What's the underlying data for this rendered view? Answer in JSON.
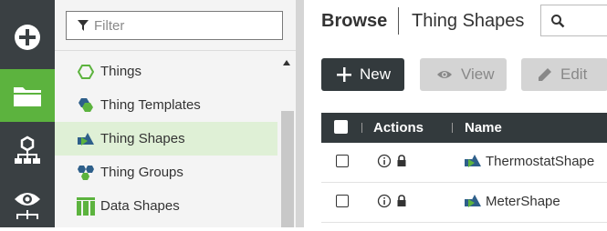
{
  "rail": {
    "items": [
      {
        "name": "add-icon",
        "active": false
      },
      {
        "name": "folder-icon",
        "active": true
      },
      {
        "name": "network-icon",
        "active": false
      },
      {
        "name": "monitoring-icon",
        "active": false
      }
    ]
  },
  "nav": {
    "filter_placeholder": "Filter",
    "items": [
      {
        "label": "Things",
        "icon": "hexagon-outline-icon",
        "selected": false
      },
      {
        "label": "Thing Templates",
        "icon": "thing-template-icon",
        "selected": false
      },
      {
        "label": "Thing Shapes",
        "icon": "thing-shape-icon",
        "selected": true
      },
      {
        "label": "Thing Groups",
        "icon": "thing-groups-icon",
        "selected": false
      },
      {
        "label": "Data Shapes",
        "icon": "data-shapes-icon",
        "selected": false
      }
    ]
  },
  "main": {
    "title": "Browse",
    "subtitle": "Thing Shapes",
    "buttons": {
      "new": "New",
      "view": "View",
      "edit": "Edit"
    },
    "table": {
      "headers": {
        "actions": "Actions",
        "name": "Name"
      },
      "rows": [
        {
          "name": "ThermostatShape"
        },
        {
          "name": "MeterShape"
        }
      ]
    }
  },
  "colors": {
    "rail_bg": "#3a4043",
    "rail_active": "#5cb33e",
    "selected_bg": "#dff0d6",
    "header_bg": "#333a3d",
    "accent_green": "#5cb33e",
    "accent_blue": "#2e5f8a"
  }
}
